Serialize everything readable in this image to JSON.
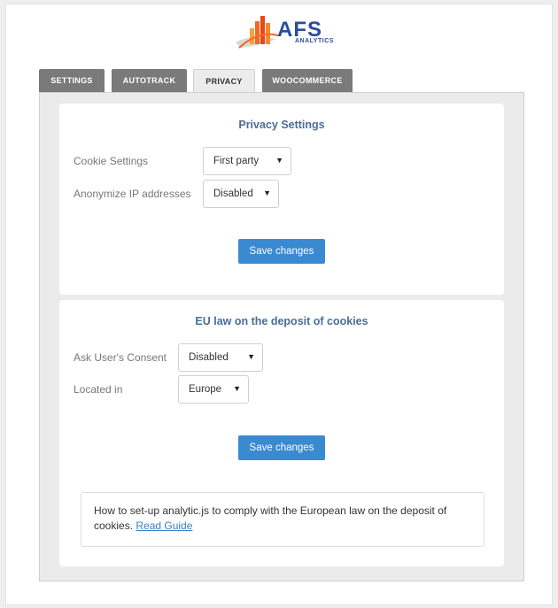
{
  "logo": {
    "text": "AFS",
    "subtext": "ANALYTICS",
    "colors": {
      "bars": "#f26a21",
      "text": "#2a4c9c"
    }
  },
  "tabs": [
    {
      "label": "SETTINGS",
      "active": false
    },
    {
      "label": "AUTOTRACK",
      "active": false
    },
    {
      "label": "PRIVACY",
      "active": true
    },
    {
      "label": "WOOCOMMERCE",
      "active": false
    }
  ],
  "privacy_settings": {
    "title": "Privacy Settings",
    "cookie_settings": {
      "label": "Cookie Settings",
      "value": "First party"
    },
    "anonymize_ip": {
      "label": "Anonymize IP addresses",
      "value": "Disabled"
    },
    "save_label": "Save changes"
  },
  "eu_law": {
    "title": "EU law on the deposit of cookies",
    "ask_consent": {
      "label": "Ask User's Consent",
      "value": "Disabled"
    },
    "located_in": {
      "label": "Located in",
      "value": "Europe"
    },
    "save_label": "Save changes",
    "info_text": "How to set-up analytic.js to comply with the European law on the deposit of cookies. ",
    "info_link": "Read Guide"
  },
  "colors": {
    "accent_button": "#3a8ad1",
    "panel_title": "#4a6d96",
    "tab_inactive": "#7a7a7a"
  }
}
